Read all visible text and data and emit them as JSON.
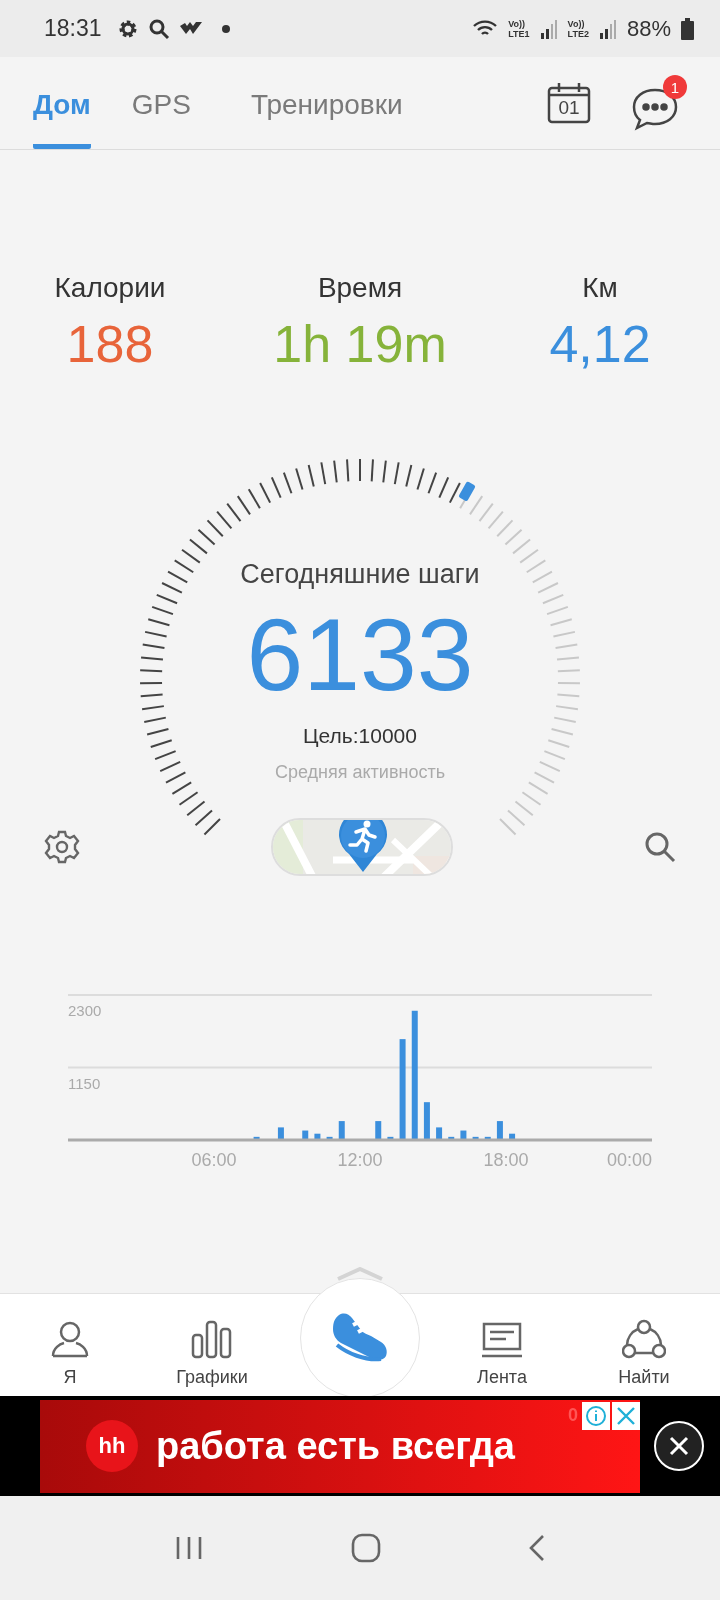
{
  "status_bar": {
    "time": "18:31",
    "sims": [
      {
        "top": "Vo))",
        "bottom": "LTE1"
      },
      {
        "top": "Vo))",
        "bottom": "LTE2"
      }
    ],
    "battery": "88%"
  },
  "tabs": [
    {
      "label": "Дом",
      "selected": true
    },
    {
      "label": "GPS",
      "selected": false
    },
    {
      "label": "Тренировки",
      "selected": false
    }
  ],
  "calendar": {
    "day": "01"
  },
  "messages": {
    "badge": "1"
  },
  "stats": [
    {
      "label": "Калории",
      "value": "188",
      "color": "#e8643a"
    },
    {
      "label": "Время",
      "value": "1h 19m",
      "color": "#86b33a"
    },
    {
      "label": "Км",
      "value": "4,12",
      "color": "#3b8fdd"
    }
  ],
  "gauge": {
    "title": "Сегодняшние шаги",
    "steps": "6133",
    "goal": "Цель:10000",
    "activity": "Средняя активность"
  },
  "activity_chart": {
    "chart_data": {
      "type": "bar",
      "xlim": [
        0,
        24
      ],
      "ylim": [
        0,
        2300
      ],
      "xticks": [
        {
          "value": 6,
          "label": "06:00"
        },
        {
          "value": 12,
          "label": "12:00"
        },
        {
          "value": 18,
          "label": "18:00"
        },
        {
          "value": 24,
          "label": "00:00"
        }
      ],
      "yticks": [
        1150,
        2300
      ],
      "x": [
        7.75,
        8.75,
        9.75,
        10.25,
        10.75,
        11.25,
        12.75,
        13.25,
        13.75,
        14.25,
        14.75,
        15.25,
        15.75,
        16.25,
        16.75,
        17.25,
        17.75,
        18.25
      ],
      "series": [
        {
          "color": "#3b8fdd",
          "values": [
            50,
            200,
            150,
            100,
            50,
            300,
            300,
            50,
            1600,
            2050,
            600,
            200,
            50,
            150,
            50,
            50,
            300,
            100
          ]
        }
      ]
    }
  },
  "bottom_nav": [
    {
      "kind": "tab",
      "label": "Я"
    },
    {
      "kind": "tab",
      "label": "Графики"
    },
    {
      "kind": "center"
    },
    {
      "kind": "tab",
      "label": "Лента"
    },
    {
      "kind": "tab",
      "label": "Найти"
    }
  ],
  "ad": {
    "logo": "hh",
    "text": "работа есть всегда",
    "counter": "0"
  }
}
